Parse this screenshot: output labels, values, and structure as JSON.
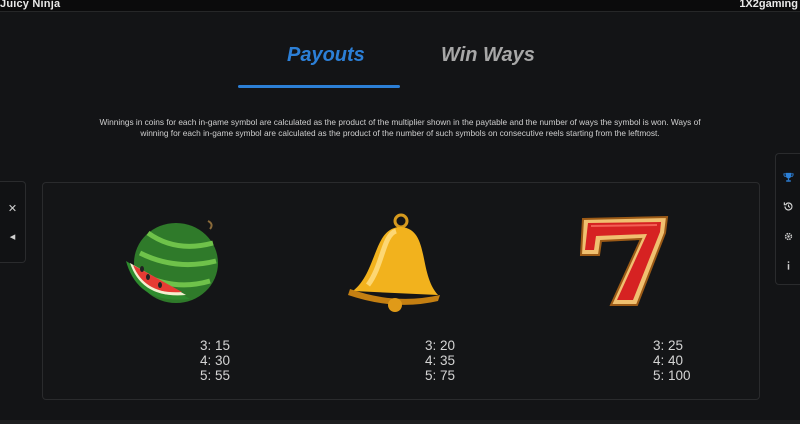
{
  "header": {
    "game_name": "Juicy Ninja",
    "provider": "1X2gaming"
  },
  "tabs": [
    {
      "label": "Payouts",
      "active": true
    },
    {
      "label": "Win Ways",
      "active": false
    }
  ],
  "description": "Winnings in coins for each in-game symbol are calculated as the product of the multiplier shown in the paytable and the number of ways the symbol is won. Ways of winning for each in-game symbol are calculated as the product of the number of such symbols on consecutive reels starting from the leftmost.",
  "symbols": [
    {
      "icon": "watermelon-icon",
      "pays": [
        "3: 15",
        "4: 30",
        "5: 55"
      ]
    },
    {
      "icon": "bell-icon",
      "pays": [
        "3: 20",
        "4: 35",
        "5: 75"
      ]
    },
    {
      "icon": "seven-icon",
      "pays": [
        "3: 25",
        "4: 40",
        "5: 100"
      ]
    }
  ],
  "left_controls": {
    "close": "✕",
    "back": "◂"
  },
  "right_controls": [
    "trophy-icon",
    "history-icon",
    "settings-icon",
    "info-icon"
  ],
  "colors": {
    "background": "#131416",
    "accent": "#2c7fd6",
    "inactive_tab": "#a7a7a7"
  }
}
